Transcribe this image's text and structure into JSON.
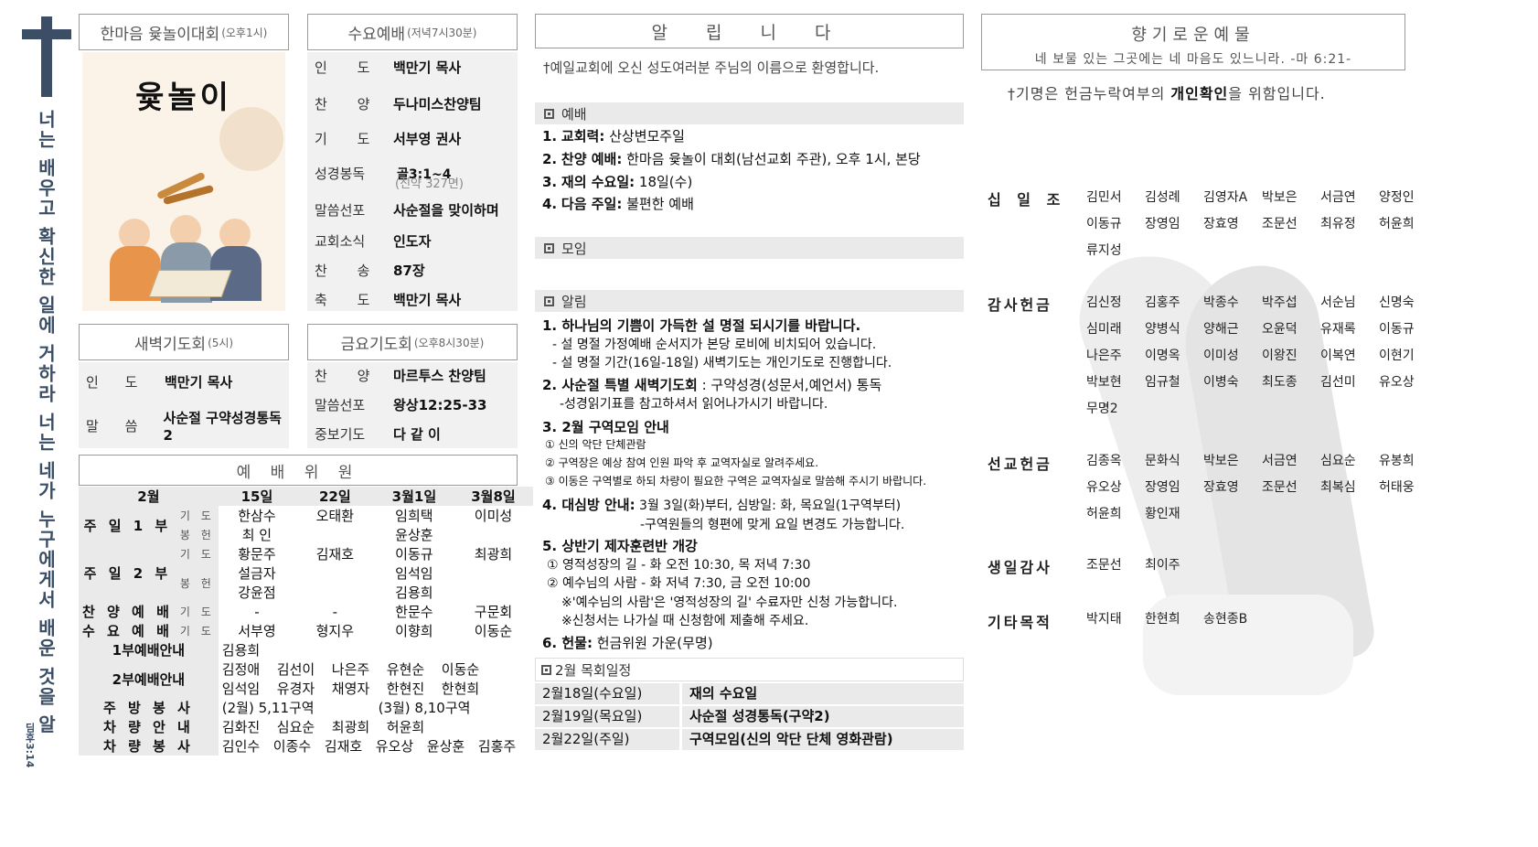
{
  "side": {
    "verse": "너는 배우고 확신한 일에 거하라 너는 네가 누구에게서 배운 것을 알며",
    "ref": "딤후3:14"
  },
  "yut": {
    "title": "한마음 윷놀이대회",
    "time": "(오후1시)",
    "poster": "윷놀이"
  },
  "wed": {
    "title": "수요예배",
    "time": "(저녁7시30분)",
    "rows": [
      {
        "label": "인 도",
        "value": "백만기 목사"
      },
      {
        "label": "찬 양",
        "value": "두나미스찬양팀"
      },
      {
        "label": "기 도",
        "value": "서부영 권사"
      },
      {
        "label": "성경봉독",
        "value": "골3:1~4",
        "sub": "(신약 327면)"
      },
      {
        "label": "말씀선포",
        "value": "사순절을 맞이하며"
      },
      {
        "label": "교회소식",
        "value": "인도자"
      },
      {
        "label": "찬 송",
        "value": "87장"
      },
      {
        "label": "축 도",
        "value": "백만기 목사"
      }
    ]
  },
  "dawn": {
    "title": "새벽기도회",
    "time": "(5시)",
    "rows": [
      {
        "label": "인 도",
        "value": "백만기 목사"
      },
      {
        "label": "말 씀",
        "value": "사순절 구약성경통독2"
      }
    ]
  },
  "fri": {
    "title": "금요기도회",
    "time": "(오후8시30분)",
    "rows": [
      {
        "label": "찬 양",
        "value": "마르투스 찬양팀"
      },
      {
        "label": "말씀선포",
        "value": "왕상12:25-33"
      },
      {
        "label": "중보기도",
        "value": "다 같 이"
      }
    ]
  },
  "committee": {
    "title": "예 배 위 원",
    "header": [
      "2월",
      "15일",
      "22일",
      "3월1일",
      "3월8일"
    ],
    "rows": [
      [
        "주 일 1 부",
        "기 도",
        "한삼수",
        "오태환",
        "임희택",
        "이미성"
      ],
      [
        "",
        "봉 헌",
        "최 인",
        "",
        "윤상훈",
        ""
      ],
      [
        "주 일 2 부",
        "기 도",
        "황문주",
        "김재호",
        "이동규",
        "최광희"
      ],
      [
        "",
        "봉 헌",
        "설금자",
        "",
        "임석임",
        ""
      ],
      [
        "",
        "",
        "강윤점",
        "",
        "김용희",
        ""
      ],
      [
        "찬 양 예 배",
        "기 도",
        "-",
        "-",
        "한문수",
        "구문회"
      ],
      [
        "수 요 예 배",
        "기 도",
        "서부영",
        "형지우",
        "이향희",
        "이동순"
      ]
    ],
    "p1_label": "1부예배안내",
    "p1_names": [
      "김용희"
    ],
    "p2_label": "2부예배안내",
    "p2_names": [
      "김정애",
      "김선이",
      "나은주",
      "유현순",
      "이동순",
      "임석임",
      "유경자",
      "채영자",
      "한현진",
      "한현희"
    ],
    "kitchen_label": "주 방 봉 사",
    "kitchen_a": "(2월) 5,11구역",
    "kitchen_b": "(3월) 8,10구역",
    "car_label": "차 량 안 내",
    "car_names": [
      "김화진",
      "심요순",
      "최광희",
      "허윤희"
    ],
    "carserv_label": "차 량 봉 사",
    "carserv_names": [
      "김인수",
      "이종수",
      "김재호",
      "유오상",
      "윤상훈",
      "김홍주"
    ]
  },
  "notice": {
    "title": "알 립 니 다",
    "welcome": "†예일교회에 오신 성도여러분 주님의 이름으로 환영합니다.",
    "worship_head": "예배",
    "worship": [
      {
        "n": "1.",
        "b": "교회력:",
        "t": " 산상변모주일"
      },
      {
        "n": "2.",
        "b": "찬양 예배:",
        "t": " 한마음 윷놀이 대회(남선교회 주관), 오후 1시, 본당"
      },
      {
        "n": "3.",
        "b": "재의 수요일:",
        "t": " 18일(수)"
      },
      {
        "n": "4.",
        "b": "다음 주일:",
        "t": " 불편한 예배"
      }
    ],
    "meeting_head": "모임",
    "news_head": "알림",
    "n1": "1. 하나님의 기쁨이 가득한 설 명절 되시기를 바랍니다.",
    "n1a": "- 설 명절 가정예배 순서지가 본당 로비에 비치되어 있습니다.",
    "n1b": "- 설 명절 기간(16일-18일) 새벽기도는 개인기도로 진행합니다.",
    "n2": "2. 사순절 특별 새벽기도회",
    "n2t": " : 구약성경(성문서,예언서) 통독",
    "n2a": "-성경읽기표를 참고하셔서 읽어나가시기 바랍니다.",
    "n3": "3. 2월 구역모임 안내",
    "n3a": "① 신의 악단 단체관람",
    "n3b": "② 구역장은 예상 참여 인원 파악 후 교역자실로 알려주세요.",
    "n3c": "③ 이동은 구역별로 하되 차량이 필요한 구역은 교역자실로 말씀해 주시기 바랍니다.",
    "n4": "4. 대심방 안내:",
    "n4t": " 3월 3일(화)부터, 심방일: 화, 목요일(1구역부터)",
    "n4a": "-구역원들의 형편에 맞게 요일 변경도 가능합니다.",
    "n5": "5. 상반기 제자훈련반 개강",
    "n5a": "① 영적성장의 길 - 화 오전 10:30, 목 저녁 7:30",
    "n5b": "② 예수님의 사람 - 화 저녁 7:30, 금 오전 10:00",
    "n5c": "※'예수님의 사람'은 '영적성장의 길' 수료자만 신청 가능합니다.",
    "n5d": "※신청서는 나가실 때 신청함에 제출해 주세요.",
    "n6": "6. 헌물:",
    "n6t": " 헌금위원 가운(무명)",
    "sched_head": "2월 목회일정",
    "sched": [
      {
        "d": "2월18일(수요일)",
        "e": "재의 수요일"
      },
      {
        "d": "2월19일(목요일)",
        "e": "사순절 성경통독(구약2)"
      },
      {
        "d": "2월22일(주일)",
        "e": "구역모임(신의 악단 단체 영화관람)"
      }
    ]
  },
  "offering": {
    "title": "향기로운예물",
    "verse": "네 보물 있는 그곳에는 네 마음도 있느니라. -마 6:21-",
    "note_a": "†기명은 헌금누락여부의 ",
    "note_b": "개인확인",
    "note_c": "을 위함입니다.",
    "groups": [
      {
        "label": "십 일 조",
        "names": [
          "김민서",
          "김성례",
          "김영자A",
          "박보은",
          "서금연",
          "양정인",
          "이동규",
          "장영임",
          "장효영",
          "조문선",
          "최유정",
          "허윤희",
          "류지성"
        ]
      },
      {
        "label": "감사헌금",
        "names": [
          "김신정",
          "김홍주",
          "박종수",
          "박주섭",
          "서순님",
          "신명숙",
          "심미래",
          "양병식",
          "양해근",
          "오윤덕",
          "유재록",
          "이동규",
          "나은주",
          "이명옥",
          "이미성",
          "이왕진",
          "이복연",
          "이현기",
          "박보현",
          "임규철",
          "이병숙",
          "최도종",
          "김선미",
          "유오상",
          "무명2"
        ]
      },
      {
        "label": "선교헌금",
        "names": [
          "김종옥",
          "문화식",
          "박보은",
          "서금연",
          "심요순",
          "유봉희",
          "유오상",
          "장영임",
          "장효영",
          "조문선",
          "최복심",
          "허태웅",
          "허윤희",
          "황인재"
        ]
      },
      {
        "label": "생일감사",
        "names": [
          "조문선",
          "최이주"
        ]
      },
      {
        "label": "기타목적",
        "names": [
          "박지태",
          "한현희",
          "송현종B"
        ]
      }
    ]
  }
}
